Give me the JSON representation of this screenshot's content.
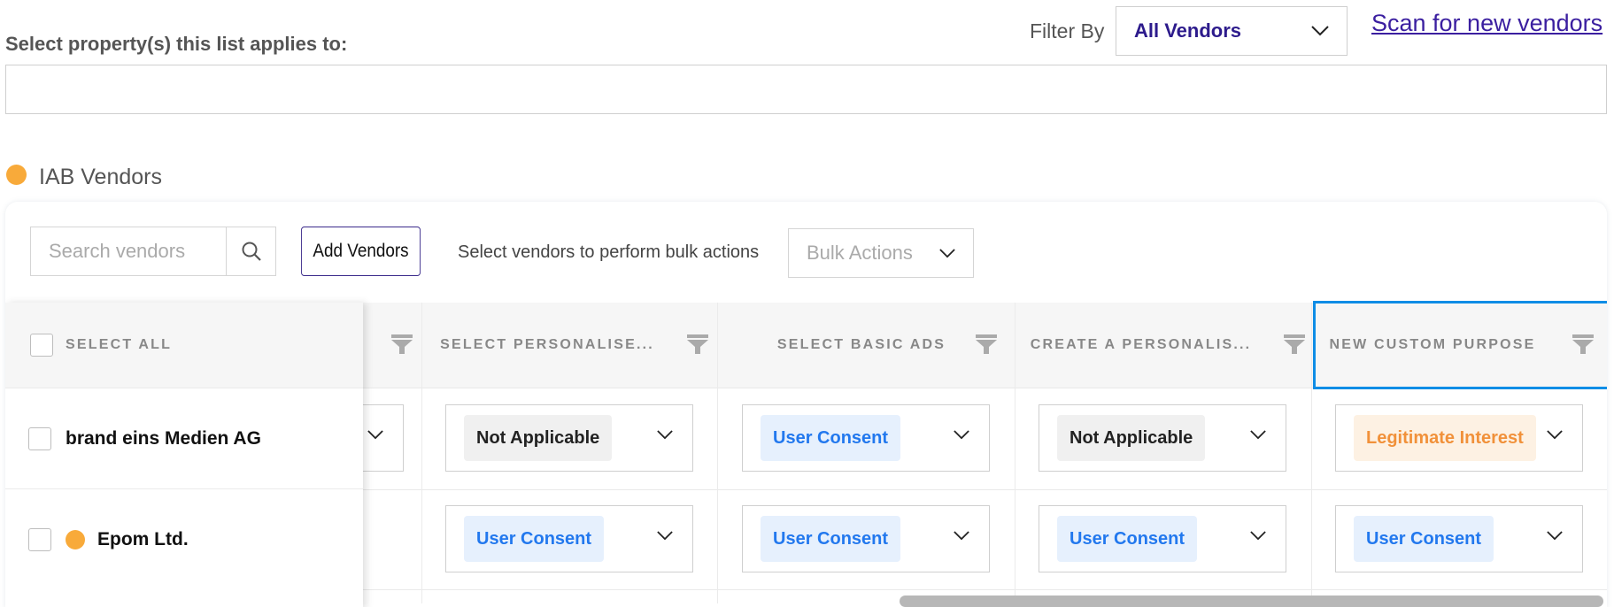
{
  "property_section": {
    "label": "Select property(s) this list applies to:",
    "input_value": ""
  },
  "filter": {
    "label": "Filter By",
    "selected": "All Vendors"
  },
  "scan_link": "Scan for new vendors",
  "section_title": "IAB Vendors",
  "toolbar": {
    "search_placeholder": "Search vendors",
    "add_vendors_label": "Add Vendors",
    "bulk_hint": "Select vendors to perform bulk actions",
    "bulk_actions_placeholder": "Bulk Actions"
  },
  "table": {
    "select_all_label": "SELECT ALL",
    "columns": [
      "",
      "SELECT PERSONALISE...",
      "SELECT BASIC ADS",
      "CREATE A PERSONALIS...",
      "NEW CUSTOM PURPOSE"
    ],
    "rows": [
      {
        "vendor": "brand eins Medien AG",
        "has_dot": false,
        "cells": [
          "Not Applicable",
          "User Consent",
          "Not Applicable",
          "Legitimate Interest"
        ]
      },
      {
        "vendor": "Epom Ltd.",
        "has_dot": true,
        "cells": [
          "User Consent",
          "User Consent",
          "User Consent",
          "User Consent"
        ]
      }
    ]
  },
  "colors": {
    "accent_purple": "#3b1fa0",
    "iab_dot": "#f8aa3a",
    "user_consent_text": "#2278ee",
    "legitimate_interest_text": "#f1913a",
    "highlight_border": "#0e8de6"
  },
  "icons": [
    "chevron-down-icon",
    "search-icon",
    "filter-funnel-icon"
  ]
}
